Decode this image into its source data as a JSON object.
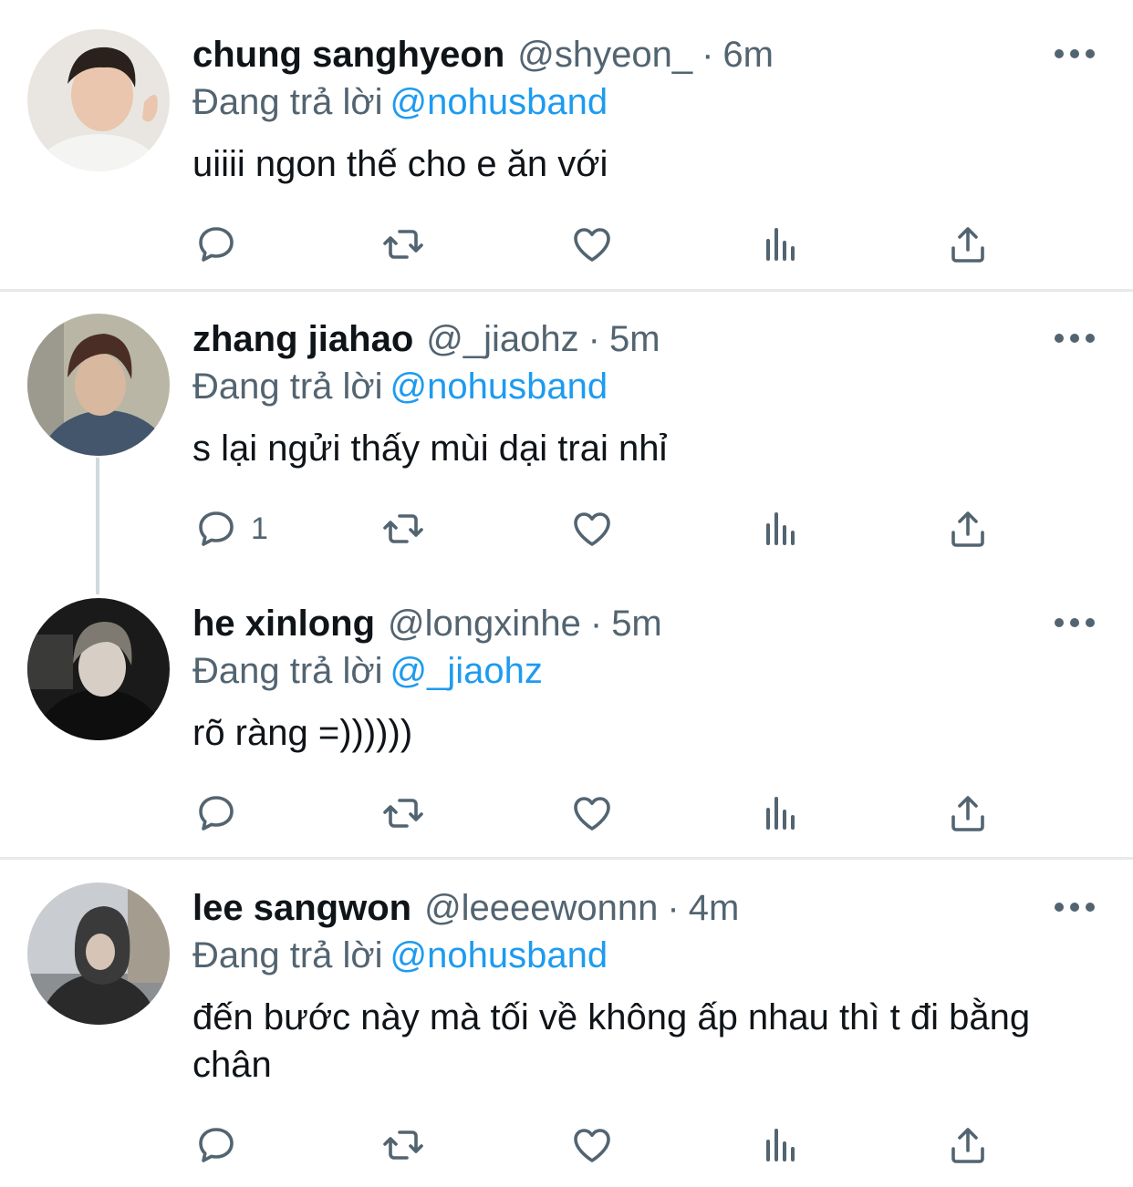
{
  "tweets": [
    {
      "name": "chung sanghyeon",
      "handle": "@shyeon_",
      "time": "6m",
      "replying_label": "Đang trả lời",
      "replying_to": "@nohusband",
      "text": "uiiii ngon thế cho e ăn với",
      "reply_count": ""
    },
    {
      "name": "zhang jiahao",
      "handle": "@_jiaohz",
      "time": "5m",
      "replying_label": "Đang trả lời",
      "replying_to": "@nohusband",
      "text": "s lại ngửi thấy mùi dại trai nhỉ",
      "reply_count": "1"
    },
    {
      "name": "he xinlong",
      "handle": "@longxinhe",
      "time": "5m",
      "replying_label": "Đang trả lời",
      "replying_to": "@_jiaohz",
      "text": "rõ ràng =))))))",
      "reply_count": ""
    },
    {
      "name": "lee sangwon",
      "handle": "@leeeewonnn",
      "time": "4m",
      "replying_label": "Đang trả lời",
      "replying_to": "@nohusband",
      "text": "đến bước này mà tối về không ấp nhau thì t đi bằng chân",
      "reply_count": ""
    }
  ],
  "separator": "·",
  "icons": [
    "reply-icon",
    "retweet-icon",
    "like-icon",
    "analytics-icon",
    "share-icon",
    "more-icon"
  ],
  "colors": {
    "text": "#0f1419",
    "secondary": "#536471",
    "mention": "#1d9bf0",
    "divider": "#e7e9ea"
  }
}
